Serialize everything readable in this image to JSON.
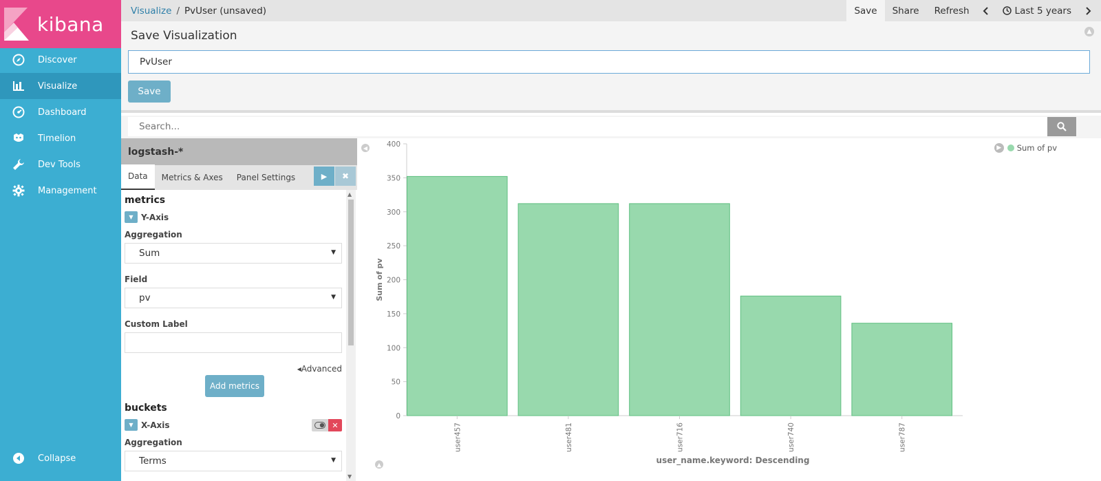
{
  "app": {
    "logo_text": "kibana"
  },
  "sidebar": {
    "items": [
      {
        "label": "Discover",
        "icon": "compass-icon"
      },
      {
        "label": "Visualize",
        "icon": "bar-chart-icon"
      },
      {
        "label": "Dashboard",
        "icon": "dashboard-icon"
      },
      {
        "label": "Timelion",
        "icon": "timelion-icon"
      },
      {
        "label": "Dev Tools",
        "icon": "wrench-icon"
      },
      {
        "label": "Management",
        "icon": "gear-icon"
      }
    ],
    "collapse_label": "Collapse"
  },
  "topbar": {
    "breadcrumb_root": "Visualize",
    "breadcrumb_sep": "/",
    "breadcrumb_current": "PvUser (unsaved)",
    "save_label": "Save",
    "share_label": "Share",
    "refresh_label": "Refresh",
    "time_label": "Last 5 years"
  },
  "save_panel": {
    "title": "Save Visualization",
    "input_value": "PvUser",
    "save_button": "Save"
  },
  "search": {
    "placeholder": "Search..."
  },
  "editor": {
    "index_pattern": "logstash-*",
    "tabs": [
      "Data",
      "Metrics & Axes",
      "Panel Settings"
    ],
    "metrics_heading": "metrics",
    "y_axis_label": "Y-Axis",
    "aggregation_label": "Aggregation",
    "aggregation_value": "Sum",
    "field_label": "Field",
    "field_value": "pv",
    "custom_label_label": "Custom Label",
    "custom_label_value": "",
    "advanced_label": "Advanced",
    "add_metrics_label": "Add metrics",
    "buckets_heading": "buckets",
    "x_axis_label": "X-Axis",
    "bucket_aggregation_label": "Aggregation",
    "bucket_aggregation_value": "Terms"
  },
  "chart_data": {
    "type": "bar",
    "categories": [
      "user457",
      "user481",
      "user716",
      "user740",
      "user787"
    ],
    "series": [
      {
        "name": "Sum of pv",
        "values": [
          352,
          312,
          312,
          176,
          136
        ],
        "color": "#98d9ad"
      }
    ],
    "xlabel": "user_name.keyword: Descending",
    "ylabel": "Sum of pv",
    "ylim": [
      0,
      400
    ],
    "yticks": [
      0,
      50,
      100,
      150,
      200,
      250,
      300,
      350,
      400
    ],
    "legend_position": "top-right",
    "grid": false
  },
  "colors": {
    "sidebar_bg": "#3caed2",
    "logo_bg": "#e8488b",
    "accent": "#6eafc8",
    "bar_fill": "#98d9ad",
    "bar_stroke": "#5fbf80"
  }
}
